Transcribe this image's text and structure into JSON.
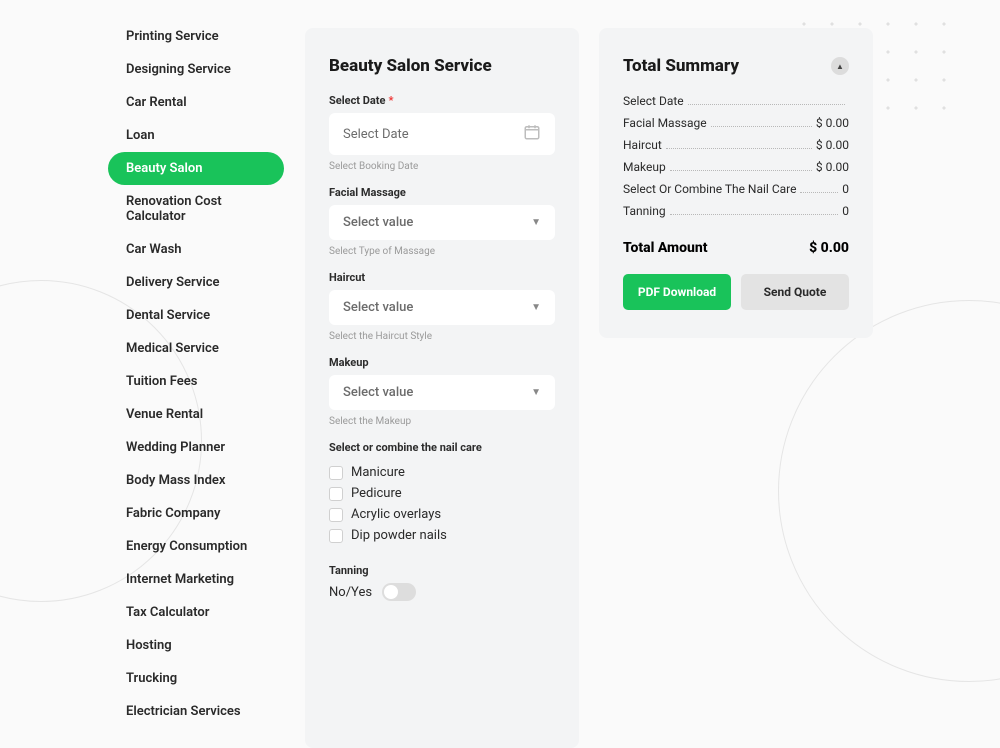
{
  "sidebar": {
    "items": [
      {
        "label": "Printing Service",
        "active": false
      },
      {
        "label": "Designing Service",
        "active": false
      },
      {
        "label": "Car Rental",
        "active": false
      },
      {
        "label": "Loan",
        "active": false
      },
      {
        "label": "Beauty Salon",
        "active": true
      },
      {
        "label": "Renovation Cost Calculator",
        "active": false
      },
      {
        "label": "Car Wash",
        "active": false
      },
      {
        "label": "Delivery Service",
        "active": false
      },
      {
        "label": "Dental Service",
        "active": false
      },
      {
        "label": "Medical Service",
        "active": false
      },
      {
        "label": "Tuition Fees",
        "active": false
      },
      {
        "label": "Venue Rental",
        "active": false
      },
      {
        "label": "Wedding Planner",
        "active": false
      },
      {
        "label": "Body Mass Index",
        "active": false
      },
      {
        "label": "Fabric Company",
        "active": false
      },
      {
        "label": "Energy Consumption",
        "active": false
      },
      {
        "label": "Internet Marketing",
        "active": false
      },
      {
        "label": "Tax Calculator",
        "active": false
      },
      {
        "label": "Hosting",
        "active": false
      },
      {
        "label": "Trucking",
        "active": false
      },
      {
        "label": "Electrician Services",
        "active": false
      }
    ]
  },
  "form": {
    "title": "Beauty Salon Service",
    "date": {
      "label": "Select Date",
      "required_marker": "*",
      "placeholder": "Select Date",
      "helper": "Select Booking Date"
    },
    "facial": {
      "label": "Facial Massage",
      "value": "Select value",
      "helper": "Select Type of Massage"
    },
    "haircut": {
      "label": "Haircut",
      "value": "Select value",
      "helper": "Select the Haircut Style"
    },
    "makeup": {
      "label": "Makeup",
      "value": "Select value",
      "helper": "Select the Makeup"
    },
    "nail": {
      "label": "Select or combine the nail care",
      "options": [
        "Manicure",
        "Pedicure",
        "Acrylic overlays",
        "Dip powder nails"
      ]
    },
    "tanning": {
      "label": "Tanning",
      "value_text": "No/Yes"
    }
  },
  "summary": {
    "title": "Total Summary",
    "lines": [
      {
        "label": "Select Date",
        "value": ""
      },
      {
        "label": "Facial Massage",
        "value": "$ 0.00"
      },
      {
        "label": "Haircut",
        "value": "$ 0.00"
      },
      {
        "label": "Makeup",
        "value": "$ 0.00"
      },
      {
        "label": "Select Or Combine The Nail Care",
        "value": "0"
      },
      {
        "label": "Tanning",
        "value": "0"
      }
    ],
    "total_label": "Total Amount",
    "total_value": "$ 0.00",
    "pdf_label": "PDF Download",
    "quote_label": "Send Quote"
  },
  "colors": {
    "accent": "#19c35a"
  }
}
